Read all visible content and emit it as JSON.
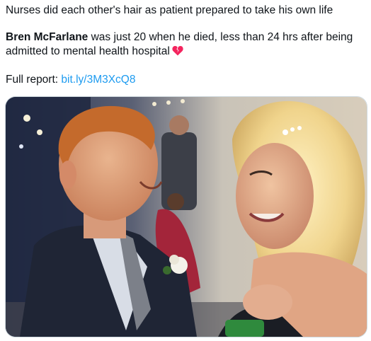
{
  "tweet": {
    "headline": "Nurses did each other's hair as patient prepared to take his own life",
    "name_bold": "Bren McFarlane",
    "body_line1_rest": " was just 20 when he died, less than 24 hrs after being",
    "body_line2": "admitted to mental health hospital",
    "heart_icon": "broken-heart-icon",
    "report_label": "Full report: ",
    "report_link": "bit.ly/3M3XcQ8",
    "link_color": "#1d9bf0",
    "text_color": "#0f1419"
  },
  "media": {
    "description_icon": "photo"
  }
}
